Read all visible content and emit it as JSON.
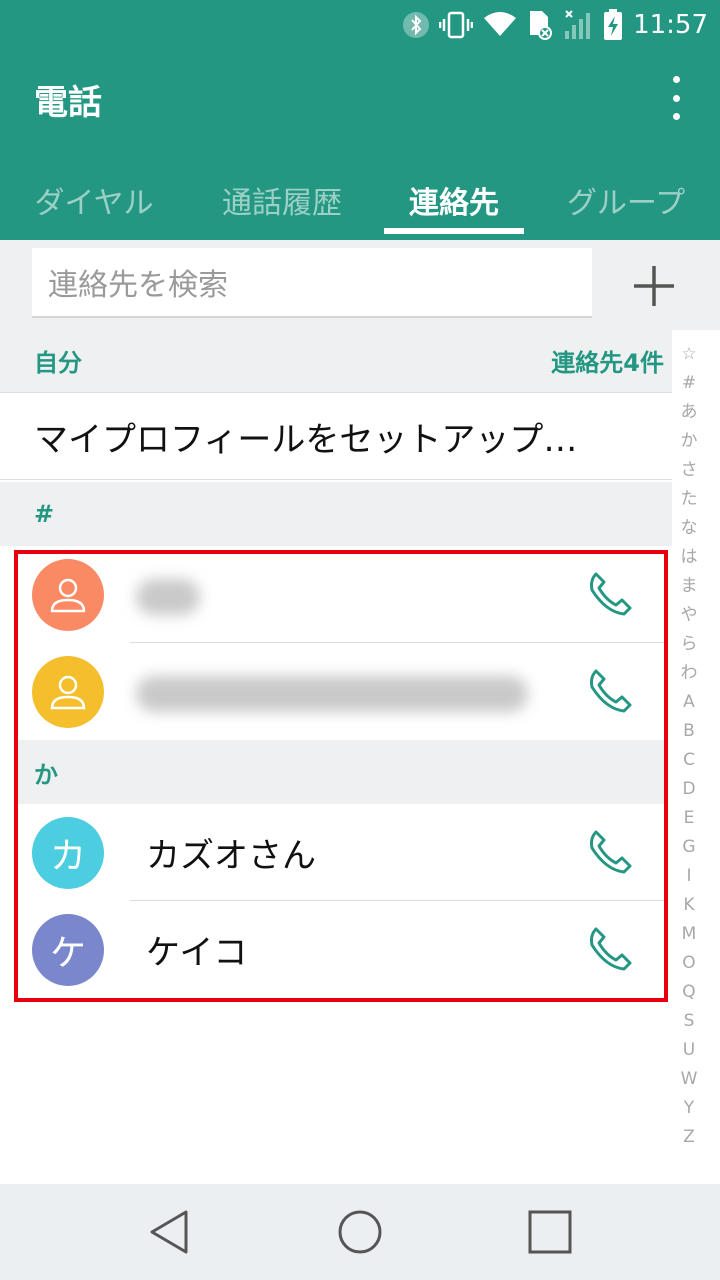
{
  "status_bar": {
    "time": "11:57",
    "icons": [
      "bluetooth-icon",
      "vibrate-icon",
      "wifi-icon",
      "sim-icon",
      "signal-icon",
      "battery-charging-icon"
    ]
  },
  "app_bar": {
    "title": "電話",
    "menu_icon": "more-vert-icon",
    "tabs": [
      {
        "label": "ダイヤル",
        "active": false
      },
      {
        "label": "通話履歴",
        "active": false
      },
      {
        "label": "連絡先",
        "active": true
      },
      {
        "label": "グループ",
        "active": false
      }
    ]
  },
  "search": {
    "placeholder": "連絡先を検索",
    "add_icon": "plus-icon"
  },
  "sections": {
    "self_label": "自分",
    "contact_count": "連絡先4件",
    "profile_setup": "マイプロフィールをセットアップ…",
    "hash_label": "#",
    "ka_label": "か"
  },
  "contacts": [
    {
      "initial": "",
      "name": "",
      "color": "#fa8a64",
      "avatar_icon": "person-icon",
      "blurred": true
    },
    {
      "initial": "",
      "name": "",
      "color": "#f5be2c",
      "avatar_icon": "person-icon",
      "blurred": true
    },
    {
      "initial": "カ",
      "name": "カズオさん",
      "color": "#4ccde0",
      "avatar_icon": "",
      "blurred": false
    },
    {
      "initial": "ケ",
      "name": "ケイコ",
      "color": "#7a87cc",
      "avatar_icon": "",
      "blurred": false
    }
  ],
  "alpha_index": [
    "☆",
    "#",
    "あ",
    "か",
    "さ",
    "た",
    "な",
    "は",
    "ま",
    "や",
    "ら",
    "わ",
    "A",
    "B",
    "C",
    "D",
    "E",
    "G",
    "I",
    "K",
    "M",
    "O",
    "Q",
    "S",
    "U",
    "W",
    "Y",
    "Z"
  ],
  "colors": {
    "accent": "#249783",
    "highlight": "#e8000c"
  },
  "nav_bar": [
    "back-icon",
    "home-icon",
    "recents-icon"
  ]
}
